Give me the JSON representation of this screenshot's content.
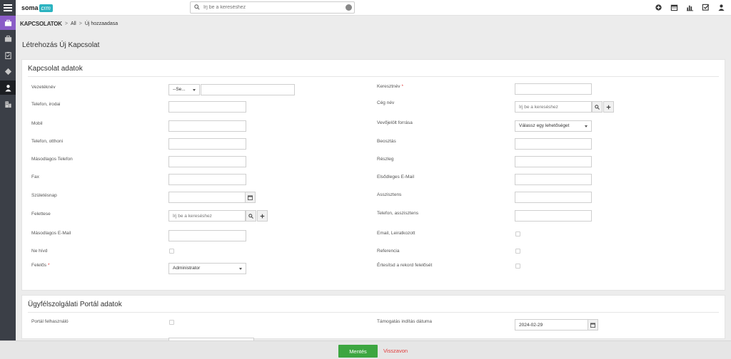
{
  "brand": {
    "name": "soma",
    "suffix": "crm"
  },
  "search": {
    "placeholder": "Írj be a kereséshez"
  },
  "breadcrumb": {
    "module": "KAPCSOLATOK",
    "all": "All",
    "current": "Új hozzaadasa"
  },
  "page_title": "Létrehozás Új Kapcsolat",
  "section1": {
    "title": "Kapcsolat adatok",
    "salutation": {
      "value": "--Se..."
    },
    "fields": {
      "last_name": "Vezetéknév",
      "first_name": "Keresztnév",
      "first_name_req": "*",
      "phone_office": "Telefon, irodai",
      "company_name": "Cég név",
      "company_placeholder": "Írj be a kereséshez",
      "mobile": "Mobil",
      "lead_source": "Vevőjelölt forrása",
      "lead_source_value": "Válassz egy lehetőséget",
      "phone_home": "Telefon, otthoni",
      "title": "Beosztás",
      "phone_other": "Másodlagos Telefon",
      "department": "Részleg",
      "fax": "Fax",
      "email_primary": "Elsődleges E-Mail",
      "birthday": "Születésnap",
      "assistant": "Asszisztens",
      "reports_to": "Felettese",
      "reports_to_placeholder": "Írj be a kereséshez",
      "phone_assistant": "Telefon, asszisztens",
      "email_secondary": "Másodlagos E-Mail",
      "email_opt_out": "Email, Leiratkozott",
      "do_not_call": "Ne hívd",
      "reference": "Referencia",
      "assigned_to": "Felelős",
      "assigned_to_req": "*",
      "assigned_to_value": "Administrator",
      "notify_owner": "Értesítsd a rekord felelősét"
    }
  },
  "section2": {
    "title": "Ügyfélszolgálati Portál adatok",
    "portal_user": "Portál felhasználó",
    "support_start": "Támogatás indítás dátuma",
    "support_start_value": "2024-02-29"
  },
  "actions": {
    "save": "Mentés",
    "cancel": "Visszavon"
  },
  "colors": {
    "sidebar": "#3b3f47",
    "accent_purple": "#8a5cc7",
    "save_green": "#3da641",
    "cancel_red": "#e03a3a",
    "logo_teal": "#2bb3c0"
  }
}
